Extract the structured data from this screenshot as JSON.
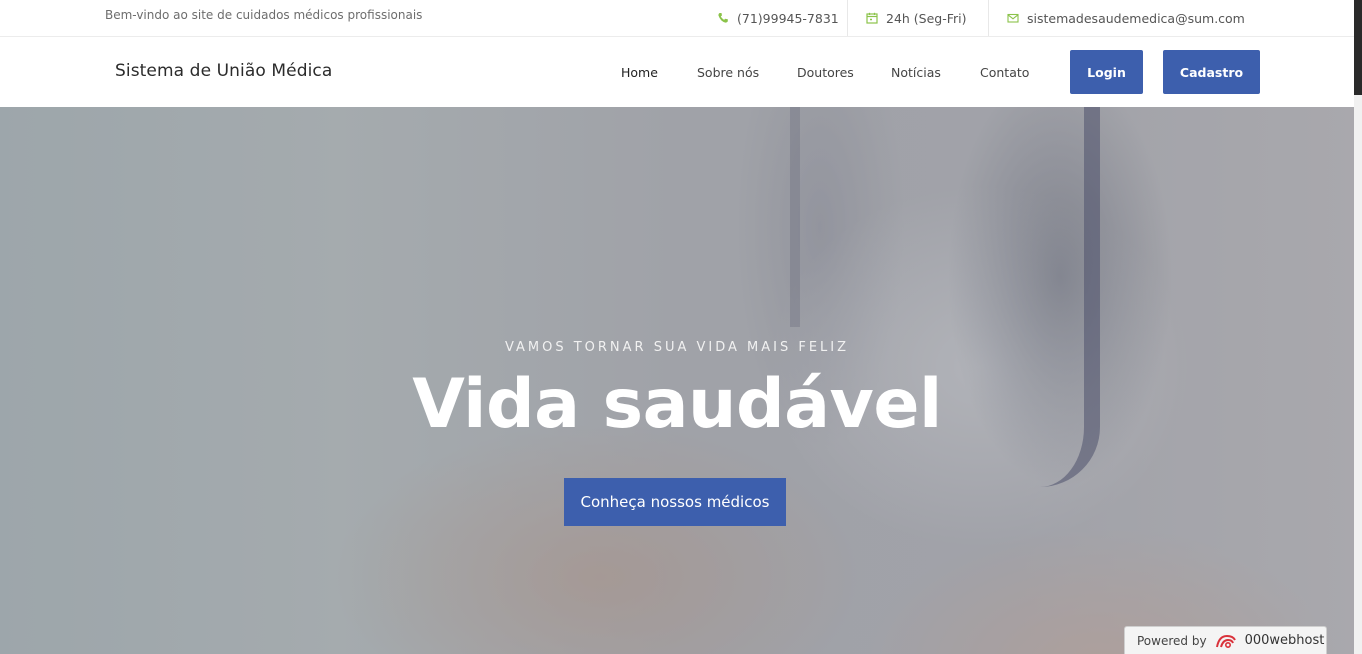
{
  "topbar": {
    "welcome": "Bem-vindo ao site de cuidados médicos profissionais",
    "phone": "(71)99945-7831",
    "hours": "24h (Seg-Fri)",
    "email": "sistemadesaudemedica@sum.com",
    "icon_color": "#8bc34a"
  },
  "navbar": {
    "brand": "Sistema de União Médica",
    "menu": [
      "Home",
      "Sobre nós",
      "Doutores",
      "Notícias",
      "Contato"
    ],
    "login": "Login",
    "signup": "Cadastro",
    "accent": "#3d5fad"
  },
  "hero": {
    "subtitle": "VAMOS TORNAR SUA VIDA MAIS FELIZ",
    "title": "Vida saudável",
    "cta": "Conheça nossos médicos"
  },
  "footer_badge": {
    "prefix": "Powered by",
    "brand": "000webhost"
  }
}
